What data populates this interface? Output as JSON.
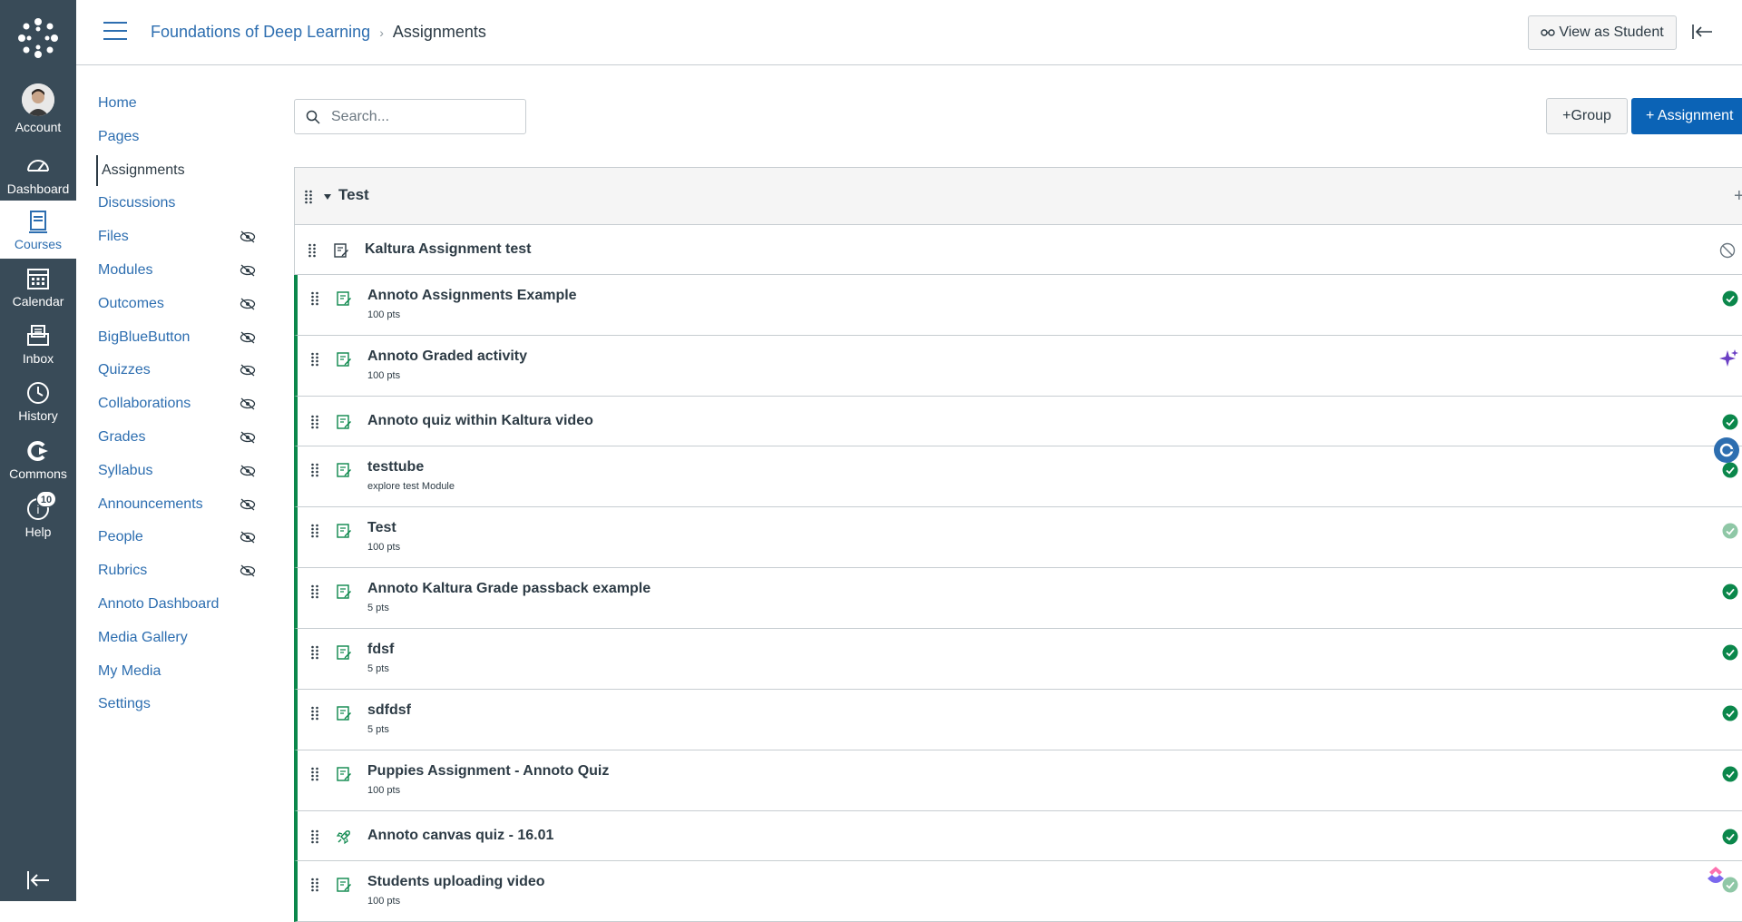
{
  "global_nav": {
    "items": [
      {
        "label": "Account",
        "icon": "avatar"
      },
      {
        "label": "Dashboard",
        "icon": "dashboard-icon"
      },
      {
        "label": "Courses",
        "icon": "courses-icon"
      },
      {
        "label": "Calendar",
        "icon": "calendar-icon"
      },
      {
        "label": "Inbox",
        "icon": "inbox-icon"
      },
      {
        "label": "History",
        "icon": "history-icon"
      },
      {
        "label": "Commons",
        "icon": "commons-icon"
      },
      {
        "label": "Help",
        "icon": "help-icon"
      }
    ],
    "help_badge": "10",
    "active": "Courses",
    "colors": {
      "background": "#394b58",
      "active_text": "#2d6eb0"
    }
  },
  "header": {
    "breadcrumb_course": "Foundations of Deep Learning",
    "breadcrumb_current": "Assignments",
    "view_as_student": "View as Student"
  },
  "course_nav": {
    "items": [
      {
        "label": "Home",
        "hidden": false
      },
      {
        "label": "Pages",
        "hidden": false
      },
      {
        "label": "Assignments",
        "hidden": false,
        "active": true
      },
      {
        "label": "Discussions",
        "hidden": false
      },
      {
        "label": "Files",
        "hidden": true
      },
      {
        "label": "Modules",
        "hidden": true
      },
      {
        "label": "Outcomes",
        "hidden": true
      },
      {
        "label": "BigBlueButton",
        "hidden": true
      },
      {
        "label": "Quizzes",
        "hidden": true
      },
      {
        "label": "Collaborations",
        "hidden": true
      },
      {
        "label": "Grades",
        "hidden": true
      },
      {
        "label": "Syllabus",
        "hidden": true
      },
      {
        "label": "Announcements",
        "hidden": true
      },
      {
        "label": "People",
        "hidden": true
      },
      {
        "label": "Rubrics",
        "hidden": true
      },
      {
        "label": "Annoto Dashboard",
        "hidden": false
      },
      {
        "label": "Media Gallery",
        "hidden": false
      },
      {
        "label": "My Media",
        "hidden": false
      },
      {
        "label": "Settings",
        "hidden": false
      }
    ]
  },
  "toolbar": {
    "search_placeholder": "Search...",
    "group_button": "Group",
    "assignment_button": "Assignment"
  },
  "assignment_group": {
    "title": "Test",
    "rows": [
      {
        "title": "Kaltura Assignment test",
        "meta": "",
        "type": "assignment",
        "status": "unpublished"
      },
      {
        "title": "Annoto Assignments Example",
        "meta": "100 pts",
        "type": "assignment",
        "status": "published"
      },
      {
        "title": "Annoto Graded activity",
        "meta": "100 pts",
        "type": "assignment",
        "status": "published"
      },
      {
        "title": "Annoto quiz within Kaltura video",
        "meta": "",
        "type": "assignment",
        "status": "published"
      },
      {
        "title": "testtube",
        "meta": "explore test Module",
        "type": "assignment",
        "status": "published"
      },
      {
        "title": "Test",
        "meta": "100 pts",
        "type": "assignment",
        "status": "published-light"
      },
      {
        "title": "Annoto Kaltura Grade passback example",
        "meta": "5 pts",
        "type": "assignment",
        "status": "published"
      },
      {
        "title": "fdsf",
        "meta": "5 pts",
        "type": "assignment",
        "status": "published"
      },
      {
        "title": "sdfdsf",
        "meta": "5 pts",
        "type": "assignment",
        "status": "published"
      },
      {
        "title": "Puppies Assignment - Annoto Quiz",
        "meta": "100 pts",
        "type": "assignment",
        "status": "published"
      },
      {
        "title": "Annoto canvas quiz - 16.01",
        "meta": "",
        "type": "quiz",
        "status": "published"
      },
      {
        "title": "Students uploading video",
        "meta": "100 pts",
        "type": "assignment",
        "status": "published-light"
      }
    ],
    "colors": {
      "published": "#0b874b",
      "link": "#2d6eb0",
      "primary_button": "#0b63b6"
    }
  }
}
